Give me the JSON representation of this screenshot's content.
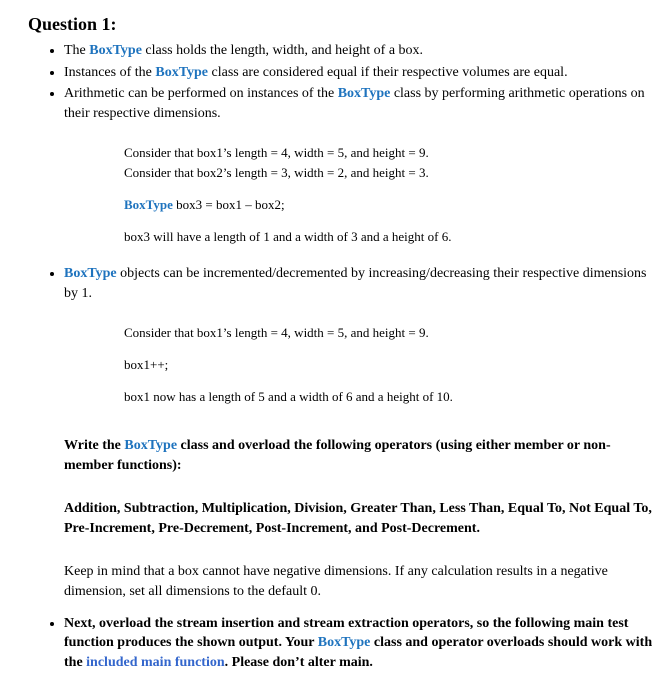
{
  "title": "Question 1:",
  "keyword": "BoxType",
  "bullets": {
    "b1_pre": "The ",
    "b1_post": " class holds the length, width, and height of a box.",
    "b2_pre": "Instances of the ",
    "b2_post": " class are considered equal if their respective volumes are equal.",
    "b3_pre": "Arithmetic can be performed on instances of the ",
    "b3_post": " class by performing arithmetic operations on their respective dimensions."
  },
  "code1": {
    "l1": "Consider that box1’s length = 4, width = 5, and height = 9.",
    "l2": "Consider that box2’s length = 3, width = 2, and height = 3.",
    "l3_post": " box3 = box1 – box2;",
    "l4": "box3 will have a length of 1 and a width of 3 and a height of 6."
  },
  "bullet4": {
    "post": " objects can be incremented/decremented by increasing/decreasing their respective dimensions by 1."
  },
  "code2": {
    "l1": "Consider that box1’s length = 4, width = 5, and height = 9.",
    "l2": "box1++;",
    "l3": "box1 now has a length of 5 and a width of 6 and a height of 10."
  },
  "write": {
    "pre": "Write the ",
    "post": " class and overload the following operators (using either member or non-member functions):"
  },
  "ops": "Addition, Subtraction, Multiplication, Division, Greater Than, Less Than, Equal To, Not Equal To, Pre-Increment, Pre-Decrement, Post-Increment, and Post-Decrement.",
  "keepmind": "Keep in mind that a box cannot have negative dimensions.  If any calculation results in a negative dimension, set all dimensions to the default 0.",
  "next": {
    "pre": "Next, overload the stream insertion and stream extraction operators, so the following main test function produces the shown output.  Your ",
    "mid": " class and operator overloads should work with the ",
    "link": "included main function",
    "post": ".  Please don’t alter main."
  }
}
